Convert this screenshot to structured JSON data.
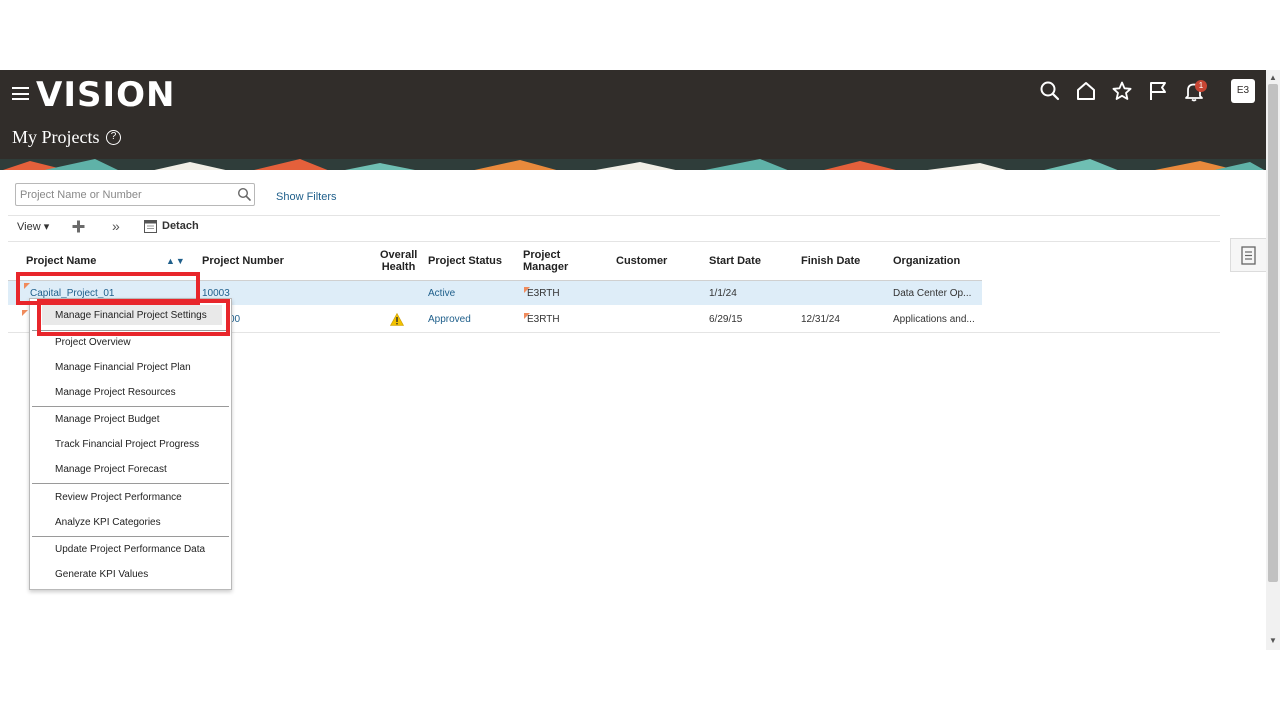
{
  "app": {
    "logo": "VISION",
    "page_title": "My Projects",
    "avatar_initials": "E3",
    "notification_count": "1"
  },
  "colors": {
    "header_bg": "#312d2a",
    "link": "#1f5f8b",
    "highlight_row": "#deedf8",
    "annotation_red": "#e8262b",
    "warning": "#f2c200"
  },
  "header_icons": [
    "search-icon",
    "home-icon",
    "star-icon",
    "flag-icon",
    "bell-icon"
  ],
  "search": {
    "placeholder": "Project Name or Number",
    "show_filters": "Show Filters"
  },
  "toolbar": {
    "view_label": "View ▾",
    "more_label": "»",
    "detach_label": "Detach"
  },
  "table": {
    "headers": {
      "project_name": "Project Name",
      "project_number": "Project Number",
      "overall_health_1": "Overall",
      "overall_health_2": "Health",
      "project_status": "Project Status",
      "project_manager_1": "Project",
      "project_manager_2": "Manager",
      "customer": "Customer",
      "start_date": "Start Date",
      "finish_date": "Finish Date",
      "organization": "Organization"
    },
    "rows": [
      {
        "project_name": "Capital_Project_01",
        "project_number": "10003",
        "overall_health": "",
        "project_status": "Active",
        "project_manager": "E3RTH",
        "customer": "",
        "start_date": "1/1/24",
        "finish_date": "",
        "organization": "Data Center Op..."
      },
      {
        "project_name": "",
        "project_number": "00",
        "overall_health": "warning",
        "project_status": "Approved",
        "project_manager": "E3RTH",
        "customer": "",
        "start_date": "6/29/15",
        "finish_date": "12/31/24",
        "organization": "Applications and..."
      }
    ]
  },
  "context_menu": {
    "items": [
      "Manage Financial Project Settings",
      "Project Overview",
      "Manage Financial Project Plan",
      "Manage Project Resources",
      "Manage Project Budget",
      "Track Financial Project Progress",
      "Manage Project Forecast",
      "Review Project Performance",
      "Analyze KPI Categories",
      "Update Project Performance Data",
      "Generate KPI Values"
    ]
  }
}
